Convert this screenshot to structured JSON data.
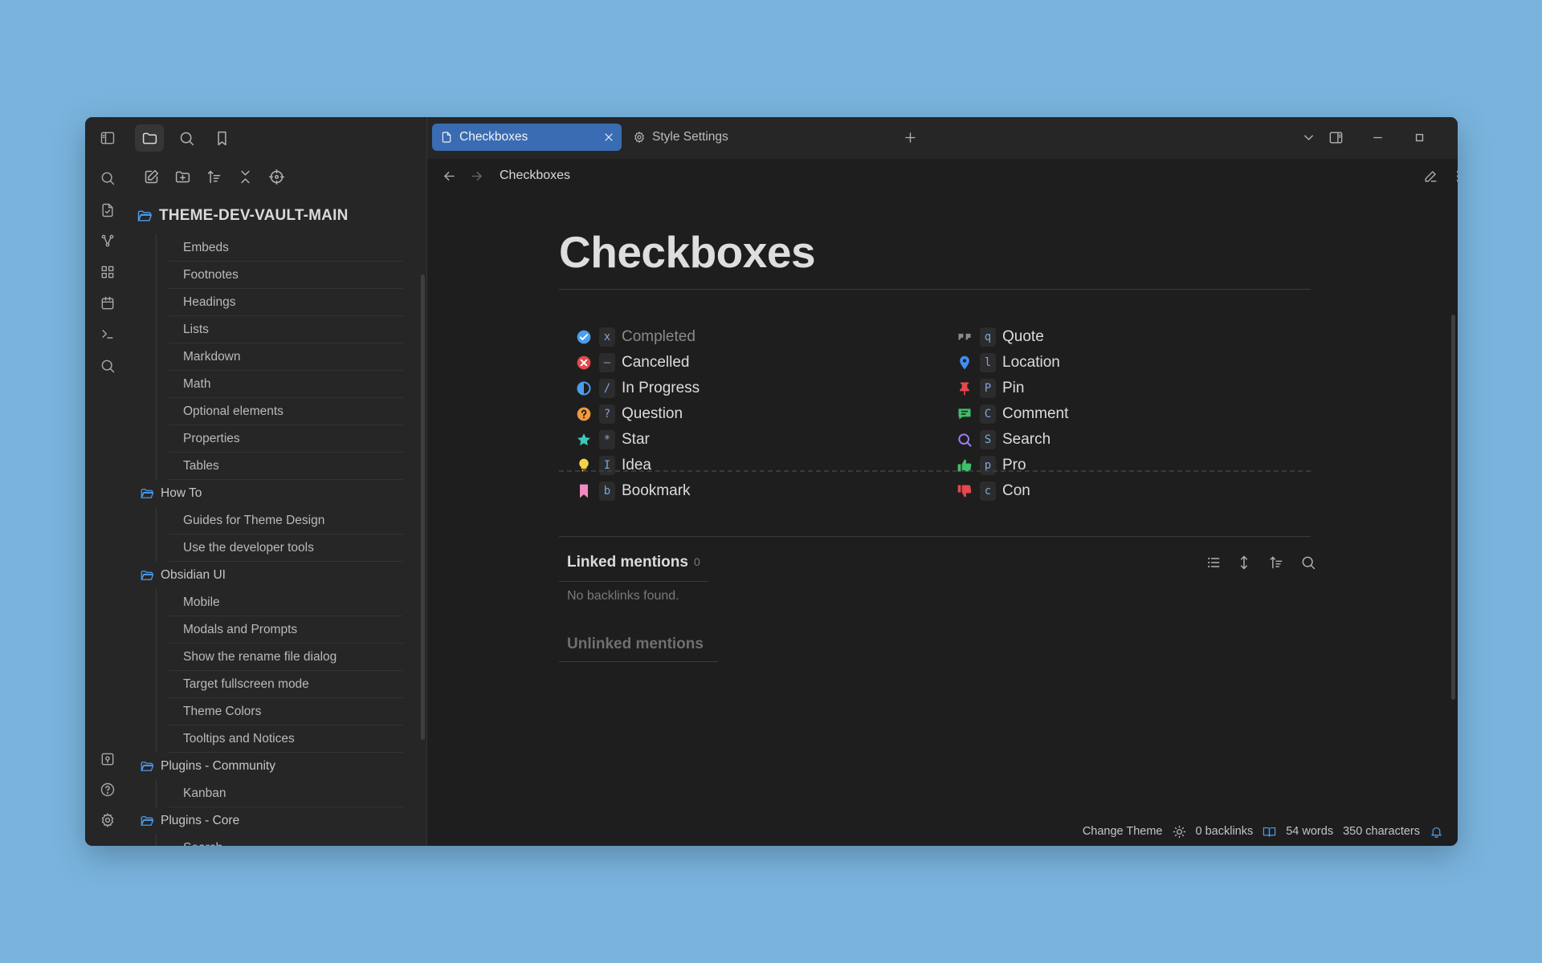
{
  "vault": {
    "name": "THEME-DEV-VAULT-MAIN"
  },
  "tree": {
    "items": [
      {
        "type": "file",
        "label": "Embeds"
      },
      {
        "type": "file",
        "label": "Footnotes"
      },
      {
        "type": "file",
        "label": "Headings"
      },
      {
        "type": "file",
        "label": "Lists"
      },
      {
        "type": "file",
        "label": "Markdown"
      },
      {
        "type": "file",
        "label": "Math"
      },
      {
        "type": "file",
        "label": "Optional elements"
      },
      {
        "type": "file",
        "label": "Properties"
      },
      {
        "type": "file",
        "label": "Tables"
      },
      {
        "type": "folder",
        "label": "How To"
      },
      {
        "type": "file",
        "label": "Guides for Theme Design"
      },
      {
        "type": "file",
        "label": "Use the developer tools"
      },
      {
        "type": "folder",
        "label": "Obsidian UI"
      },
      {
        "type": "file",
        "label": "Mobile"
      },
      {
        "type": "file",
        "label": "Modals and Prompts"
      },
      {
        "type": "file",
        "label": "Show the rename file dialog"
      },
      {
        "type": "file",
        "label": "Target fullscreen mode"
      },
      {
        "type": "file",
        "label": "Theme Colors"
      },
      {
        "type": "file",
        "label": "Tooltips and Notices"
      },
      {
        "type": "folder",
        "label": "Plugins - Community"
      },
      {
        "type": "file",
        "label": "Kanban"
      },
      {
        "type": "folder",
        "label": "Plugins - Core"
      },
      {
        "type": "file",
        "label": "Search"
      }
    ]
  },
  "tabs": [
    {
      "label": "Checkboxes",
      "icon": "file-icon",
      "active": true
    },
    {
      "label": "Style Settings",
      "icon": "gear-icon",
      "active": false
    }
  ],
  "navbar": {
    "breadcrumb": "Checkboxes"
  },
  "document": {
    "title": "Checkboxes",
    "left_checkboxes": [
      {
        "key": "x",
        "label": "Completed",
        "icon": "check-circle-icon",
        "color": "#4a9df0"
      },
      {
        "key": "–",
        "label": "Cancelled",
        "icon": "x-circle-icon",
        "color": "#e5484d"
      },
      {
        "key": "/",
        "label": "In Progress",
        "icon": "half-circle-icon",
        "color": "#4a9df0"
      },
      {
        "key": "?",
        "label": "Question",
        "icon": "question-circle-icon",
        "color": "#f09a3e"
      },
      {
        "key": "*",
        "label": "Star",
        "icon": "star-icon",
        "color": "#3cc9b8"
      },
      {
        "key": "I",
        "label": "Idea",
        "icon": "bulb-icon",
        "color": "#f5d547"
      },
      {
        "key": "b",
        "label": "Bookmark",
        "icon": "bookmark-icon",
        "color": "#f08bc0"
      }
    ],
    "right_checkboxes": [
      {
        "key": "q",
        "label": "Quote",
        "icon": "quote-icon",
        "color": "#8a8a8a"
      },
      {
        "key": "l",
        "label": "Location",
        "icon": "map-pin-icon",
        "color": "#3f8ef0"
      },
      {
        "key": "P",
        "label": "Pin",
        "icon": "pushpin-icon",
        "color": "#e5484d"
      },
      {
        "key": "C",
        "label": "Comment",
        "icon": "comment-icon",
        "color": "#3fbf6b"
      },
      {
        "key": "S",
        "label": "Search",
        "icon": "search-icon",
        "color": "#a07cf0"
      },
      {
        "key": "p",
        "label": "Pro",
        "icon": "thumbs-up-icon",
        "color": "#3fbf6b"
      },
      {
        "key": "c",
        "label": "Con",
        "icon": "thumbs-down-icon",
        "color": "#e5484d"
      }
    ]
  },
  "backlinks": {
    "linked_heading": "Linked mentions",
    "linked_count": "0",
    "empty_text": "No backlinks found.",
    "unlinked_heading": "Unlinked mentions"
  },
  "status": {
    "theme": "Change Theme",
    "backlinks": "0 backlinks",
    "words": "54 words",
    "characters": "350 characters"
  }
}
